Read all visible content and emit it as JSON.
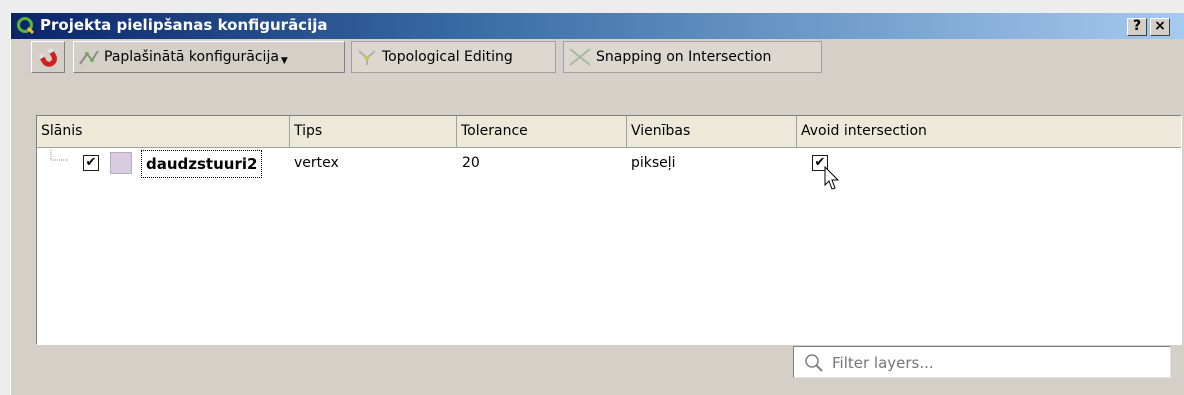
{
  "window": {
    "title": "Projekta pielipšanas konfigurācija",
    "help_button": "?",
    "close_button": "×"
  },
  "toolbar": {
    "advanced_label": "Paplašinātā konfigurācija",
    "topological_label": "Topological Editing",
    "intersection_label": "Snapping on Intersection"
  },
  "table": {
    "headers": [
      "Slānis",
      "Tips",
      "Tolerance",
      "Vienības",
      "Avoid intersection"
    ],
    "rows": [
      {
        "layer": "daudzstuuri2",
        "layer_checked": true,
        "type": "vertex",
        "tolerance": "20",
        "units": "pikseļi",
        "avoid_intersection": true
      }
    ]
  },
  "filter": {
    "placeholder": "Filter layers..."
  },
  "colors": {
    "title_gradient_start": "#0a246a",
    "title_gradient_end": "#a6caf0",
    "layer_swatch": "#d8cce0",
    "dialog_bg": "#d4d0c8"
  }
}
